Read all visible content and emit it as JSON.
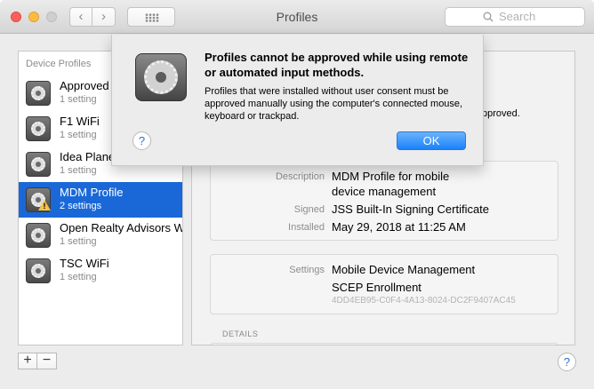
{
  "window": {
    "title": "Profiles"
  },
  "toolbar": {
    "back_icon": "‹",
    "forward_icon": "›",
    "search_placeholder": "Search"
  },
  "sidebar": {
    "header": "Device Profiles",
    "items": [
      {
        "name": "Approved",
        "sub": "1 setting",
        "warning": false,
        "selected": false
      },
      {
        "name": "F1 WiFi",
        "sub": "1 setting",
        "warning": false,
        "selected": false
      },
      {
        "name": "Idea Planet",
        "sub": "1 setting",
        "warning": false,
        "selected": false
      },
      {
        "name": "MDM Profile",
        "sub": "2 settings",
        "warning": true,
        "selected": true
      },
      {
        "name": "Open Realty Advisors WiFi",
        "sub": "1 setting",
        "warning": false,
        "selected": false
      },
      {
        "name": "TSC WiFi",
        "sub": "1 setting",
        "warning": false,
        "selected": false
      }
    ],
    "warning_mark": "!"
  },
  "controls": {
    "add_label": "+",
    "remove_label": "−",
    "help_label": "?"
  },
  "detail": {
    "trailing_text": "pproved.",
    "description_label": "Description",
    "description_value_1": "MDM Profile for mobile",
    "description_value_2": "device management",
    "signed_label": "Signed",
    "signed_value": "JSS Built-In Signing Certificate",
    "installed_label": "Installed",
    "installed_value": "May 29, 2018 at 11:25 AM",
    "settings_label": "Settings",
    "settings_value_1": "Mobile Device Management",
    "settings_value_2": "SCEP Enrollment",
    "settings_id": "4DD4EB95-C0F4-4A13-8024-DC2F9407AC45",
    "details_label": "DETAILS"
  },
  "alert": {
    "title": "Profiles cannot be approved while using remote or automated input methods.",
    "body": "Profiles that were installed without user consent must be approved manually using the computer's connected mouse, keyboard or trackpad.",
    "ok_label": "OK",
    "help_label": "?"
  },
  "colors": {
    "selection": "#1a68d8",
    "ok_button": "#1a82fb",
    "close": "#fc605c",
    "minimize": "#fdbc40",
    "warning": "#f6c344"
  }
}
